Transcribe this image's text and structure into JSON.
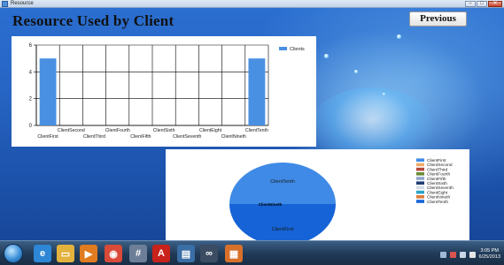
{
  "window": {
    "title": "Resource",
    "minimize_glyph": "–",
    "maximize_glyph": "□",
    "close_glyph": "✕"
  },
  "page": {
    "title": "Resource Used by Client",
    "previous_label": "Previous"
  },
  "chart_data": [
    {
      "type": "bar",
      "categories": [
        "ClientFirst",
        "ClientSecond",
        "ClientThird",
        "ClientFourth",
        "ClientFifth",
        "ClientSixth",
        "ClientSeventh",
        "ClientEight",
        "ClientNineth",
        "ClientTenth"
      ],
      "series": [
        {
          "name": "Clients",
          "values": [
            5,
            0,
            0,
            0,
            0,
            0,
            0,
            0,
            0,
            5
          ]
        }
      ],
      "yticks": [
        "0",
        "2",
        "4",
        "6"
      ],
      "ylim": [
        0,
        6
      ],
      "grid": true,
      "legend": "top-right",
      "color": "#4a90e2"
    },
    {
      "type": "pie",
      "labels": [
        "ClientFirst",
        "ClientSecond",
        "ClientThird",
        "ClientFourth",
        "ClientFifth",
        "ClientSixth",
        "ClientSeventh",
        "ClientEight",
        "ClientNineth",
        "ClientTenth"
      ],
      "values": [
        5,
        0,
        0,
        0,
        0,
        0,
        0,
        0,
        0,
        5
      ],
      "colors": [
        "#3f8ae6",
        "#f0a868",
        "#b5473a",
        "#6b8e3a",
        "#8fa6c9",
        "#1f3f73",
        "#d6dde8",
        "#2aa3c8",
        "#e07b39",
        "#1563d6"
      ],
      "slice_labels": {
        "top": "ClientTenth",
        "bottom": "ClientFirst",
        "middle": "ClientNineth"
      },
      "legend": "top-right"
    }
  ],
  "taskbar": {
    "icons": [
      {
        "name": "ie-icon",
        "glyph": "e",
        "color": "#2d86d6"
      },
      {
        "name": "folder-icon",
        "glyph": "▭",
        "color": "#e3b23c"
      },
      {
        "name": "media-player-icon",
        "glyph": "▶",
        "color": "#e07b1f"
      },
      {
        "name": "chrome-icon",
        "glyph": "◉",
        "color": "#d94a38"
      },
      {
        "name": "calculator-icon",
        "glyph": "#",
        "color": "#6d7f98"
      },
      {
        "name": "pdf-icon",
        "glyph": "A",
        "color": "#c8221b"
      },
      {
        "name": "screen-icon",
        "glyph": "▤",
        "color": "#3a6ea5"
      },
      {
        "name": "infinity-icon",
        "glyph": "∞",
        "color": "#3b4c63"
      },
      {
        "name": "office-icon",
        "glyph": "▦",
        "color": "#d7702a"
      }
    ],
    "clock_time": "3:05 PM",
    "clock_date": "6/25/2013"
  }
}
